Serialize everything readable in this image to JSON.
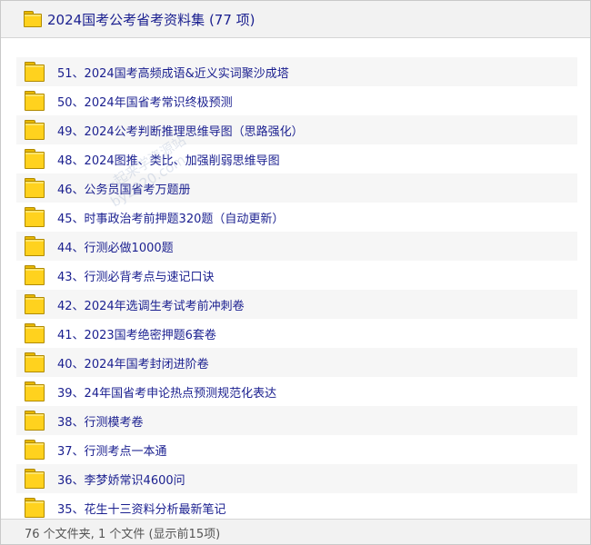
{
  "window": {
    "title": "2024国考公考省考资料集 (77 项)",
    "icon": "folder-icon"
  },
  "list": {
    "items": [
      {
        "label": "51、2024国考高频成语&近义实词聚沙成塔"
      },
      {
        "label": "50、2024年国省考常识终极预测"
      },
      {
        "label": "49、2024公考判断推理思维导图（思路强化）"
      },
      {
        "label": "48、2024图推、类比、加强削弱思维导图"
      },
      {
        "label": "46、公务员国省考万题册"
      },
      {
        "label": "45、时事政治考前押题320题（自动更新）"
      },
      {
        "label": "44、行测必做1000题"
      },
      {
        "label": "43、行测必背考点与速记口诀"
      },
      {
        "label": "42、2024年选调生考试考前冲刺卷"
      },
      {
        "label": "41、2023国考绝密押题6套卷"
      },
      {
        "label": "40、2024年国考封闭进阶卷"
      },
      {
        "label": "39、24年国省考申论热点预测规范化表达"
      },
      {
        "label": "38、行测模考卷"
      },
      {
        "label": "37、行测考点一本通"
      },
      {
        "label": "36、李梦娇常识4600问"
      },
      {
        "label": "35、花生十三资料分析最新笔记"
      }
    ]
  },
  "status": {
    "text": "76 个文件夹, 1 个文件 (显示前15项)"
  },
  "watermark": {
    "line1": "一起来学资源站",
    "line2": "by2020.com"
  },
  "colors": {
    "text": "#1a1f8f",
    "folder": "#ffd21e",
    "row_alt": "#f6f6f6",
    "bar": "#f2f2f2"
  }
}
